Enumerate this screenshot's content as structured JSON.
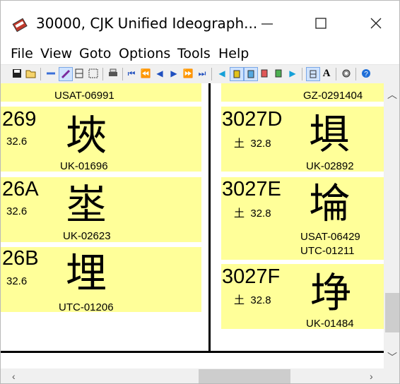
{
  "window": {
    "title": "30000, CJK Unified Ideograph..."
  },
  "menu": [
    "File",
    "View",
    "Goto",
    "Options",
    "Tools",
    "Help"
  ],
  "toolbar": {
    "icons": [
      "save-icon",
      "open-icon",
      "back-icon",
      "brush-icon",
      "grid-icon",
      "grid2-icon",
      "print-icon",
      "first-icon",
      "prev-prev-icon",
      "prev-icon",
      "next-icon",
      "next-next-icon",
      "last-icon",
      "blue-left-icon",
      "plane1-icon",
      "plane2-icon",
      "plane3-icon",
      "plane4-icon",
      "blue-right-icon",
      "frame-icon",
      "font-a-icon",
      "settings-icon",
      "help-icon"
    ],
    "font_a": "A"
  },
  "left_column": [
    {
      "source_top": "USAT-06991"
    },
    {
      "code": "269",
      "radical": "32.6",
      "glyph": "埉",
      "source": "UK-01696"
    },
    {
      "code": "26A",
      "radical": "32.6",
      "glyph": "埊",
      "source": "UK-02623"
    },
    {
      "code": "26B",
      "radical": "32.6",
      "glyph": "埋",
      "source": "UTC-01206"
    }
  ],
  "right_column": [
    {
      "source_top": "GZ-0291404"
    },
    {
      "code": "3027D",
      "radical_char": "土",
      "radical": "32.8",
      "glyph": "埧",
      "source": "UK-02892"
    },
    {
      "code": "3027E",
      "radical_char": "土",
      "radical": "32.8",
      "glyph": "埨",
      "source": "USAT-06429",
      "source2": "UTC-01211"
    },
    {
      "code": "3027F",
      "radical_char": "土",
      "radical": "32.8",
      "glyph": "埩",
      "source": "UK-01484"
    }
  ],
  "colors": {
    "cell": "#ffff99"
  }
}
